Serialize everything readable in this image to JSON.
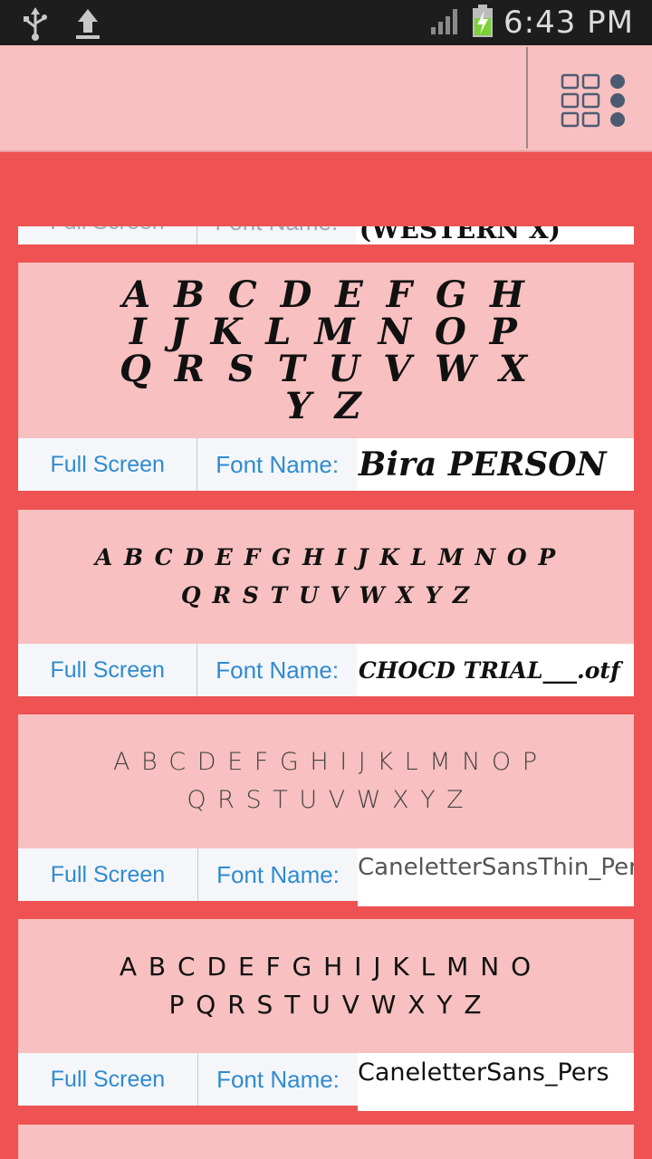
{
  "status_bar": {
    "time": "6:43 PM",
    "icons": [
      "usb-icon",
      "upload-icon",
      "signal-icon",
      "battery-charging-icon"
    ]
  },
  "app_bar": {
    "menu_icon": "grid-menu-icon"
  },
  "cards": [
    {
      "preview": "",
      "full_screen_label": "Full Screen",
      "font_name_label": "Font Name:",
      "font_name_value": "(WESTERN X)"
    },
    {
      "preview": "A B C D E F G H I J K L M N O P Q R S T U V W X Y Z",
      "full_screen_label": "Full Screen",
      "font_name_label": "Font Name:",
      "font_name_value": "Bira PERSON"
    },
    {
      "preview": "A B C D E F G H I J K L M N O P Q R S T U V W X Y Z",
      "full_screen_label": "Full Screen",
      "font_name_label": "Font Name:",
      "font_name_value": "CHOCD TRIAL___.otf"
    },
    {
      "preview": "A B C D E F G H I J K L M N O P Q R S T U V W X Y Z",
      "full_screen_label": "Full Screen",
      "font_name_label": "Font Name:",
      "font_name_value": "CaneletterSansThin_Per"
    },
    {
      "preview": "A B C D E F G H I J K L M N O P Q R S T U V W X Y Z",
      "full_screen_label": "Full Screen",
      "font_name_label": "Font Name:",
      "font_name_value": "CaneletterSans_Pers"
    }
  ]
}
